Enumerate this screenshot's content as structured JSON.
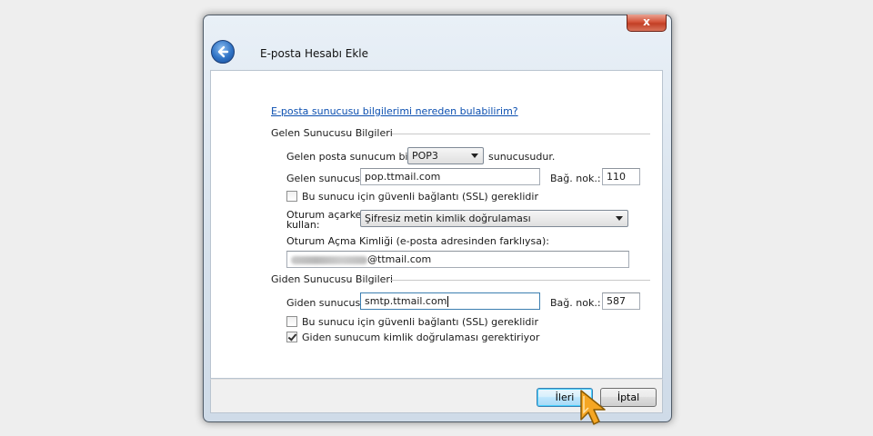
{
  "window": {
    "title": "E-posta Hesabı Ekle",
    "close_label": "x"
  },
  "help_link": "E-posta sunucusu bilgilerimi nereden bulabilirim?",
  "incoming": {
    "section_title": "Gelen Sunucusu Bilgileri",
    "type_label_before": "Gelen posta sunucum bir",
    "type_value": "POP3",
    "type_label_after": "sunucusudur.",
    "server_label": "Gelen sunucusu:",
    "server_value": "pop.ttmail.com",
    "port_label": "Bağ. nok.:",
    "port_value": "110",
    "ssl_label": "Bu sunucu için güvenli bağlantı (SSL) gereklidir",
    "ssl_checked": false,
    "logon_label_line1": "Oturum açarken",
    "logon_label_line2": "kullan:",
    "logon_value": "Şifresiz metin kimlik doğrulaması",
    "logon_id_label": "Oturum Açma Kimliği (e-posta adresinden farklıysa):",
    "logon_id_value": "@ttmail.com"
  },
  "outgoing": {
    "section_title": "Giden Sunucusu Bilgileri",
    "server_label": "Giden sunucusu:",
    "server_value": "smtp.ttmail.com",
    "port_label": "Bağ. nok.:",
    "port_value": "587",
    "ssl_label": "Bu sunucu için güvenli bağlantı (SSL) gereklidir",
    "ssl_checked": false,
    "auth_label": "Giden sunucum kimlik doğrulaması gerektiriyor",
    "auth_checked": true
  },
  "buttons": {
    "next": "İleri",
    "cancel": "İptal"
  },
  "colors": {
    "link": "#0b4fb0",
    "close_button": "#c23f25",
    "back_button": "#2f72c4",
    "cursor": "#f5a623"
  },
  "icons": {
    "back": "back-arrow-icon",
    "close": "close-icon",
    "cursor": "mouse-pointer-icon"
  }
}
